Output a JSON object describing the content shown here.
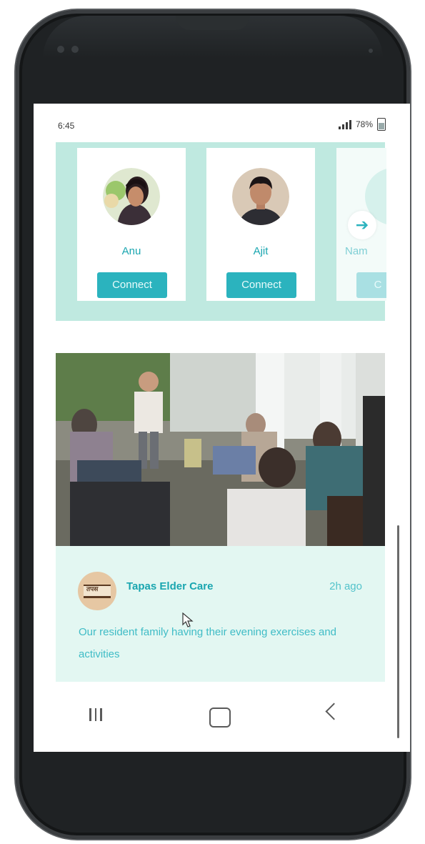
{
  "status_bar": {
    "time": "6:45",
    "battery": "78%"
  },
  "suggestions": [
    {
      "name": "Anu",
      "action": "Connect"
    },
    {
      "name": "Ajit",
      "action": "Connect"
    },
    {
      "name": "Nam",
      "action": "C"
    }
  ],
  "post": {
    "author": "Tapas Elder Care",
    "time": "2h ago",
    "caption": "Our resident family having their evening exercises and activities"
  },
  "colors": {
    "accent": "#2bb3be",
    "strip_bg": "#bfe9e0",
    "post_bg": "#e3f7f2"
  }
}
